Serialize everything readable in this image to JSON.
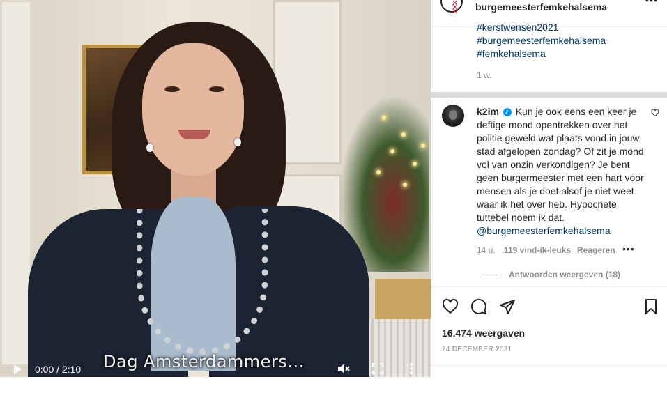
{
  "video": {
    "subtitle": "Dag Amsterdammers...",
    "time": "0:00 / 2:10",
    "icons": [
      "play-icon",
      "mute-icon",
      "fullscreen-icon",
      "more-vertical-icon"
    ]
  },
  "post": {
    "username": "burgemeesterfemkehalsema",
    "hashtags": [
      "#kerstwensen2021",
      "#burgemeesterfemkehalsema",
      "#femkehalsema"
    ],
    "age": "1 w."
  },
  "comment": {
    "username": "k2im",
    "text": "Kun je ook eens een keer je deftige mond opentrekken over het politie geweld wat plaats vond in jouw stad afgelopen zondag? Of zit je mond vol van onzin verkondigen? Je bent geen burgermeester met een hart voor mensen als je doet alsof je niet weet waar ik het over heb. Hypocriete tuttebel noem ik dat. ",
    "mention": "@burgemeesterfemkehalsema",
    "age": "14 u.",
    "likes": "119 vind-ik-leuks",
    "reply_label": "Reageren",
    "view_replies": "Antwoorden weergeven (18)"
  },
  "stats": {
    "views": "16.474 weergaven",
    "date": "24 DECEMBER 2021"
  },
  "colors": {
    "link": "#00376b",
    "secondary_text": "#8e8e8e",
    "verified": "#0095f6"
  }
}
